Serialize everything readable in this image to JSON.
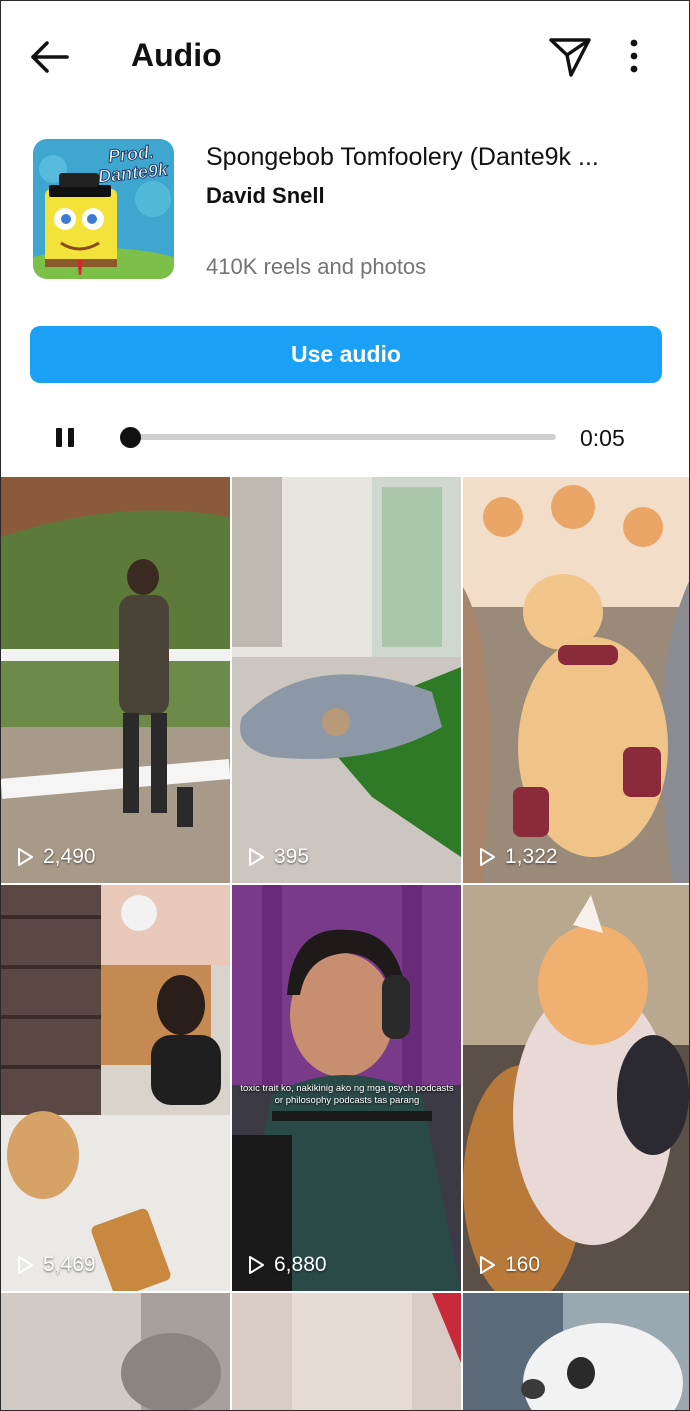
{
  "header": {
    "title": "Audio",
    "back_icon": "arrow-left-icon",
    "share_icon": "paper-plane-icon",
    "more_icon": "vertical-dots-icon"
  },
  "audio": {
    "cover_text": "Prod. Dante9k",
    "title": "Spongebob Tomfoolery (Dante9k ...",
    "artist": "David Snell",
    "count": "410K reels and photos"
  },
  "actions": {
    "use_audio_label": "Use audio"
  },
  "player": {
    "state": "playing",
    "pause_icon": "pause-icon",
    "progress": 0.0,
    "time": "0:05"
  },
  "colors": {
    "accent": "#1aa1f6",
    "text_primary": "#111111",
    "text_secondary": "#747474",
    "track": "#cfcfcf"
  },
  "grid": {
    "items": [
      {
        "views": "2,490",
        "icon": "play-icon"
      },
      {
        "views": "395",
        "icon": "play-icon"
      },
      {
        "views": "1,322",
        "icon": "play-icon"
      },
      {
        "views": "5,469",
        "icon": "play-icon"
      },
      {
        "views": "6,880",
        "icon": "play-icon",
        "caption": "toxic trait ko, nakikinig ako ng mga psych podcasts or philosophy podcasts tas parang"
      },
      {
        "views": "160",
        "icon": "play-icon"
      },
      {
        "views": "",
        "icon": "play-icon"
      },
      {
        "views": "",
        "icon": "play-icon"
      },
      {
        "views": "",
        "icon": "play-icon"
      }
    ]
  }
}
